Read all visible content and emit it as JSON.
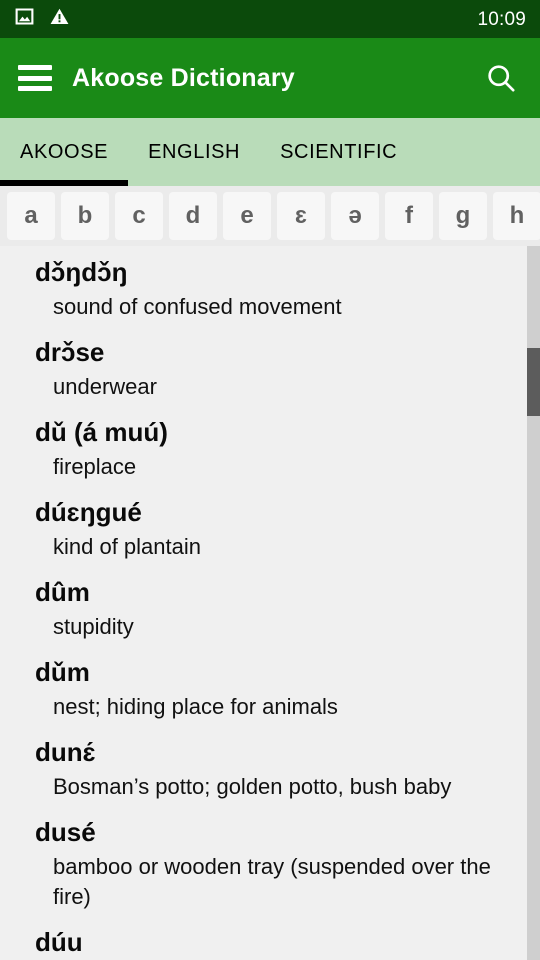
{
  "status_bar": {
    "clock": "10:09",
    "icons": [
      "image-icon",
      "warning-icon"
    ],
    "background_color": "#0b4a0b"
  },
  "app_bar": {
    "title": "Akoose Dictionary",
    "menu_icon": "hamburger-menu-icon",
    "search_icon": "search-icon",
    "background_color": "#1a8a17"
  },
  "tabs": {
    "active_index": 0,
    "background_color": "#b9dcb9",
    "indicator_color": "#000000",
    "items": [
      {
        "label": "AKOOSE"
      },
      {
        "label": "ENGLISH"
      },
      {
        "label": "SCIENTIFIC"
      }
    ]
  },
  "alphabet_bar": {
    "background_color": "#ebebeb",
    "letters": [
      "a",
      "b",
      "c",
      "d",
      "e",
      "ɛ",
      "ə",
      "f",
      "g",
      "h"
    ]
  },
  "entries": [
    {
      "headword": "dɔ̌ŋdɔ̌ŋ",
      "definition": "sound of confused movement"
    },
    {
      "headword": "drɔ̌se",
      "definition": "underwear"
    },
    {
      "headword": "dǔ (á muú)",
      "definition": "fireplace"
    },
    {
      "headword": "dúɛŋgué",
      "definition": "kind of plantain"
    },
    {
      "headword": "dûm",
      "definition": "stupidity"
    },
    {
      "headword": "dǔm",
      "definition": "nest; hiding place for animals"
    },
    {
      "headword": "dunɛ́",
      "definition": "Bosman’s potto; golden potto, bush baby"
    },
    {
      "headword": "dusé",
      "definition": "bamboo or wooden tray (suspended over the fire)"
    },
    {
      "headword": "dúu",
      "definition": ""
    }
  ],
  "scrollbar": {
    "track_color": "#cfcfcf",
    "thumb_color": "#5c5c5c"
  }
}
